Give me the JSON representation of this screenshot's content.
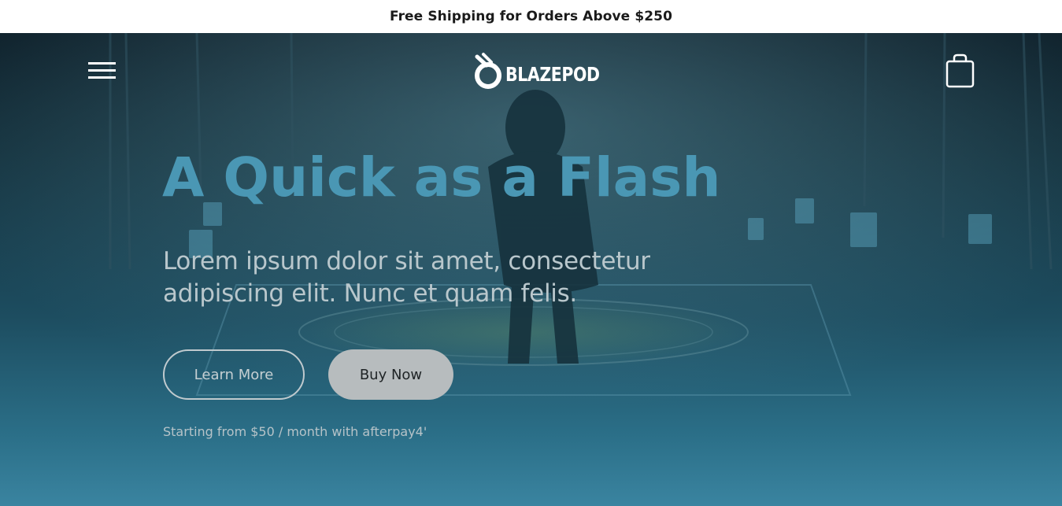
{
  "announcement": {
    "text": "Free Shipping for Orders Above $250"
  },
  "header": {
    "menu_icon": "hamburger-menu-icon",
    "logo_icon": "blazepod-logo-icon",
    "logo_text": "BLAZEPOD",
    "cart_icon": "shopping-bag-icon"
  },
  "hero": {
    "headline": "A Quick as a Flash",
    "subheading": "Lorem ipsum dolor sit amet, consectetur adipiscing elit. Nunc et quam felis.",
    "learn_more_label": "Learn More",
    "buy_now_label": "Buy Now",
    "financing_text": "Starting from $50 / month with afterpay4'"
  },
  "colors": {
    "headline": "#4a97b4",
    "hero_bottom": "#3a84a0",
    "buy_button": "#b7bcbe"
  }
}
